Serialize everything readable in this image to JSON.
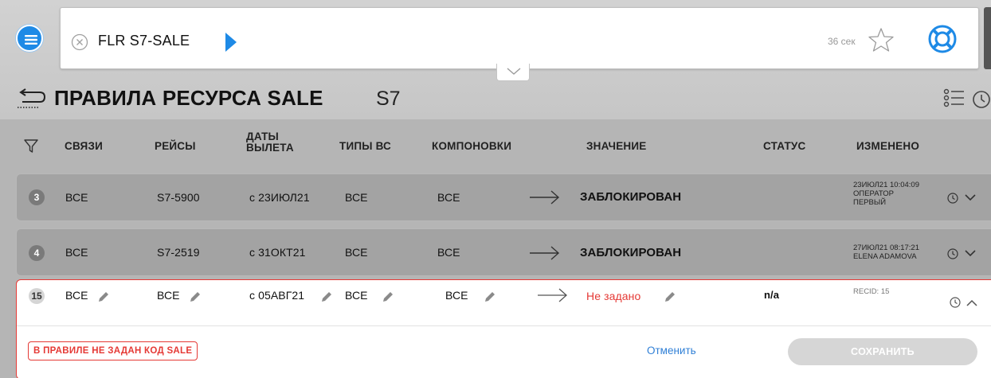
{
  "command": {
    "text": "FLR S7-SALE",
    "timer": "36 сек"
  },
  "page": {
    "title": "ПРАВИЛА РЕСУРСА SALE",
    "subtitle": "S7"
  },
  "columns": {
    "links": "СВЯЗИ",
    "flights": "РЕЙСЫ",
    "dates_l1": "ДАТЫ",
    "dates_l2": "ВЫЛЕТА",
    "aircraft": "ТИПЫ ВС",
    "layouts": "КОМПОНОВКИ",
    "value": "ЗНАЧЕНИЕ",
    "status": "СТАТУС",
    "changed": "ИЗМЕНЕНО"
  },
  "rows": [
    {
      "num": "3",
      "links": "ВСЕ",
      "flights": "S7-5900",
      "dates": "с 23ИЮЛ21",
      "aircraft": "ВСЕ",
      "layouts": "ВСЕ",
      "value": "ЗАБЛОКИРОВАН",
      "changed_l1": "23ИЮЛ21 10:04:09",
      "changed_l2": "ОПЕРАТОР",
      "changed_l3": "ПЕРВЫЙ"
    },
    {
      "num": "4",
      "links": "ВСЕ",
      "flights": "S7-2519",
      "dates": "с 31ОКТ21",
      "aircraft": "ВСЕ",
      "layouts": "ВСЕ",
      "value": "ЗАБЛОКИРОВАН",
      "changed_l1": "27ИЮЛ21 08:17:21",
      "changed_l2": "ELENA ADAMOVA"
    }
  ],
  "edit_row": {
    "num": "15",
    "links": "ВСЕ",
    "flights": "ВСЕ",
    "dates": "с 05АВГ21",
    "aircraft": "ВСЕ",
    "layouts": "ВСЕ",
    "value": "Не задано",
    "status": "n/a",
    "recid": "RECID: 15",
    "error": "В ПРАВИЛЕ НЕ ЗАДАН КОД SALE",
    "cancel": "Отменить",
    "save": "СОХРАНИТЬ"
  },
  "colors": {
    "accent": "#1e8ae6",
    "error": "#e53935",
    "link": "#2f7fd6"
  }
}
